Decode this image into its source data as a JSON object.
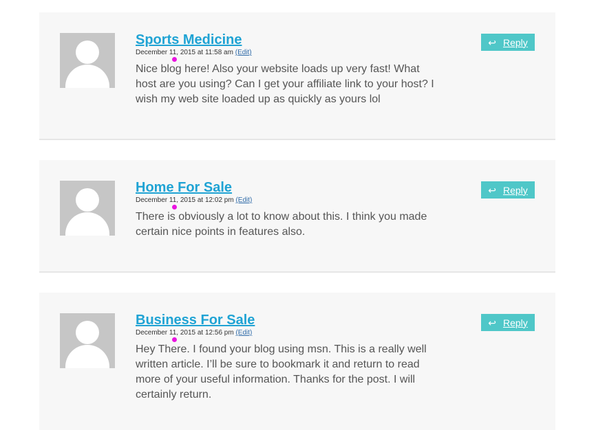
{
  "comments": [
    {
      "author": "Sports Medicine",
      "date": "December 11, 2015 at 11:58 am",
      "edit_label": "(Edit)",
      "text": "Nice blog here! Also your website loads up very fast! What host are you using? Can I get your affiliate link to your host? I wish my web site loaded up as quickly as yours lol",
      "reply_label": "Reply"
    },
    {
      "author": "Home For Sale",
      "date": "December 11, 2015 at 12:02 pm",
      "edit_label": "(Edit)",
      "text": "There is obviously a lot to know about this. I think you made certain nice points in features also.",
      "reply_label": "Reply"
    },
    {
      "author": "Business For Sale",
      "date": "December 11, 2015 at 12:56 pm",
      "edit_label": "(Edit)",
      "text": "Hey There. I found your blog using msn. This is a really well written article. I’ll be sure to bookmark it and return to read more of your useful information. Thanks for the post. I will certainly return.",
      "reply_label": "Reply"
    }
  ],
  "icons": {
    "reply": "reply-arrow-icon",
    "avatar": "default-avatar-icon"
  },
  "colors": {
    "author_link": "#1fa3d4",
    "reply_button": "#4fc7c8",
    "card_bg": "#f7f7f7",
    "marker_dot": "#ea14e0"
  }
}
